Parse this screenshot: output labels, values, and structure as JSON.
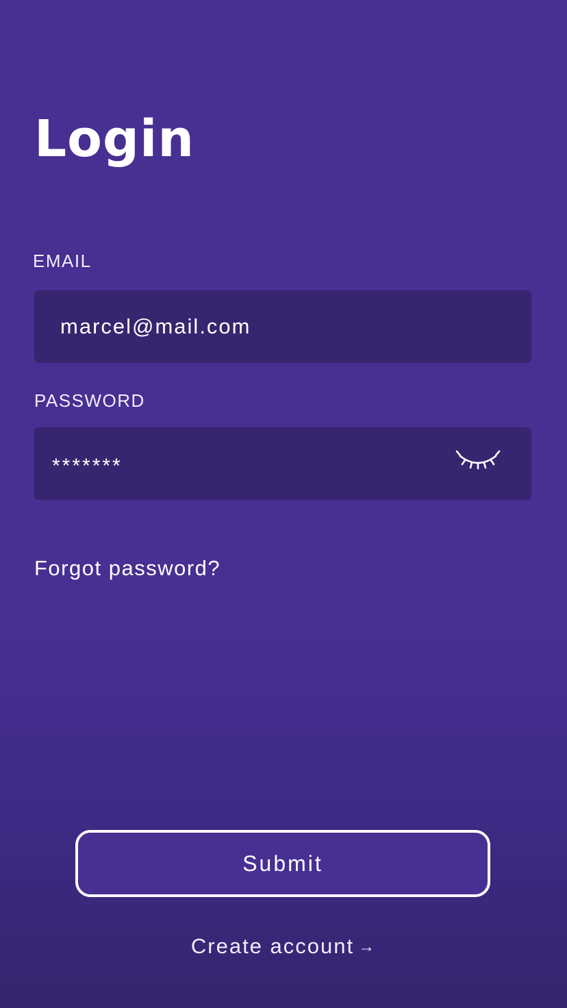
{
  "page": {
    "title": "Login"
  },
  "email": {
    "label": "EMAIL",
    "value": "marcel@mail.com"
  },
  "password": {
    "label": "PASSWORD",
    "value": "*******",
    "toggle_icon": "eye-closed-icon"
  },
  "links": {
    "forgot_password": "Forgot password?",
    "create_account": "Create account",
    "create_account_arrow": "→"
  },
  "actions": {
    "submit_label": "Submit"
  },
  "colors": {
    "background": "#482f92",
    "field_background": "#37256f",
    "text": "#ffffff"
  }
}
